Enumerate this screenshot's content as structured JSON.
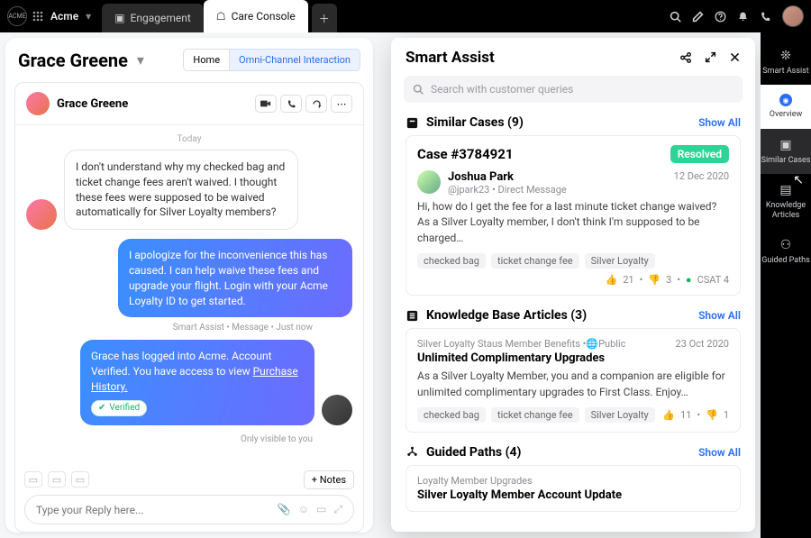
{
  "topbar": {
    "tenant": "Acme",
    "tabs": [
      {
        "label": "Engagement",
        "active": false
      },
      {
        "label": "Care Console",
        "active": true
      }
    ],
    "logo_text": "ACME"
  },
  "left": {
    "title": "Grace Greene",
    "crumbs": {
      "home": "Home",
      "context": "Omni-Channel Interaction"
    },
    "chat": {
      "name": "Grace Greene",
      "day": "Today",
      "customer_msg": "I don't understand why my checked bag and ticket change fees aren't waived.  I thought these fees were supposed to be waived automatically for Silver Loyalty members?",
      "agent_msg": "I apologize for the inconvenience this has caused. I can help waive these fees and upgrade your flight. Login with your Acme Loyalty ID to get started.",
      "agent_meta": "Smart Assist • Message • Just now",
      "sys_msg_pre": "Grace has logged into Acme. Account Verified. You have access to view ",
      "sys_msg_link": "Purchase History.",
      "verified": "Verified",
      "only": "Only visible to you",
      "notes_btn": "+  Notes",
      "placeholder": "Type your Reply here..."
    }
  },
  "sa": {
    "title": "Smart Assist",
    "search_placeholder": "Search with customer queries",
    "similar": {
      "title": "Similar Cases (9)",
      "show_all": "Show All",
      "case_no": "Case #3784921",
      "status": "Resolved",
      "author": "Joshua Park",
      "handle": "@jpark23 • Direct Message",
      "date": "12 Dec 2020",
      "body": "Hi, how do I get the fee for a last minute ticket change waived? As a Silver Loyalty member, I don't think I'm supposed to be charged…",
      "tags": [
        "checked bag",
        "ticket change fee",
        "Silver Loyalty"
      ],
      "up": "21",
      "down": "3",
      "csat": "CSAT 4"
    },
    "kb": {
      "title": "Knowledge Base Articles (3)",
      "show_all": "Show All",
      "crumb": "Silver Loyalty Staus Member Benefits • ",
      "vis": "Public",
      "date": "23 Oct 2020",
      "article_title": "Unlimited Complimentary Upgrades",
      "body": "As a Silver Loyalty Member, you and a companion are eligible for unlimited complimentary upgrades to First Class. Enjoy…",
      "tags": [
        "checked bag",
        "ticket change fee",
        "Silver Loyalty"
      ],
      "up": "11",
      "down": "1"
    },
    "gp": {
      "title": "Guided Paths (4)",
      "show_all": "Show All",
      "group": "Loyalty Member Upgrades",
      "name": "Silver Loyalty Member Account Update"
    }
  },
  "rail": {
    "items": [
      {
        "label": "Smart Assist"
      },
      {
        "label": "Overview"
      },
      {
        "label": "Similar Cases"
      },
      {
        "label": "Knowledge Articles"
      },
      {
        "label": "Guided Paths"
      }
    ]
  }
}
